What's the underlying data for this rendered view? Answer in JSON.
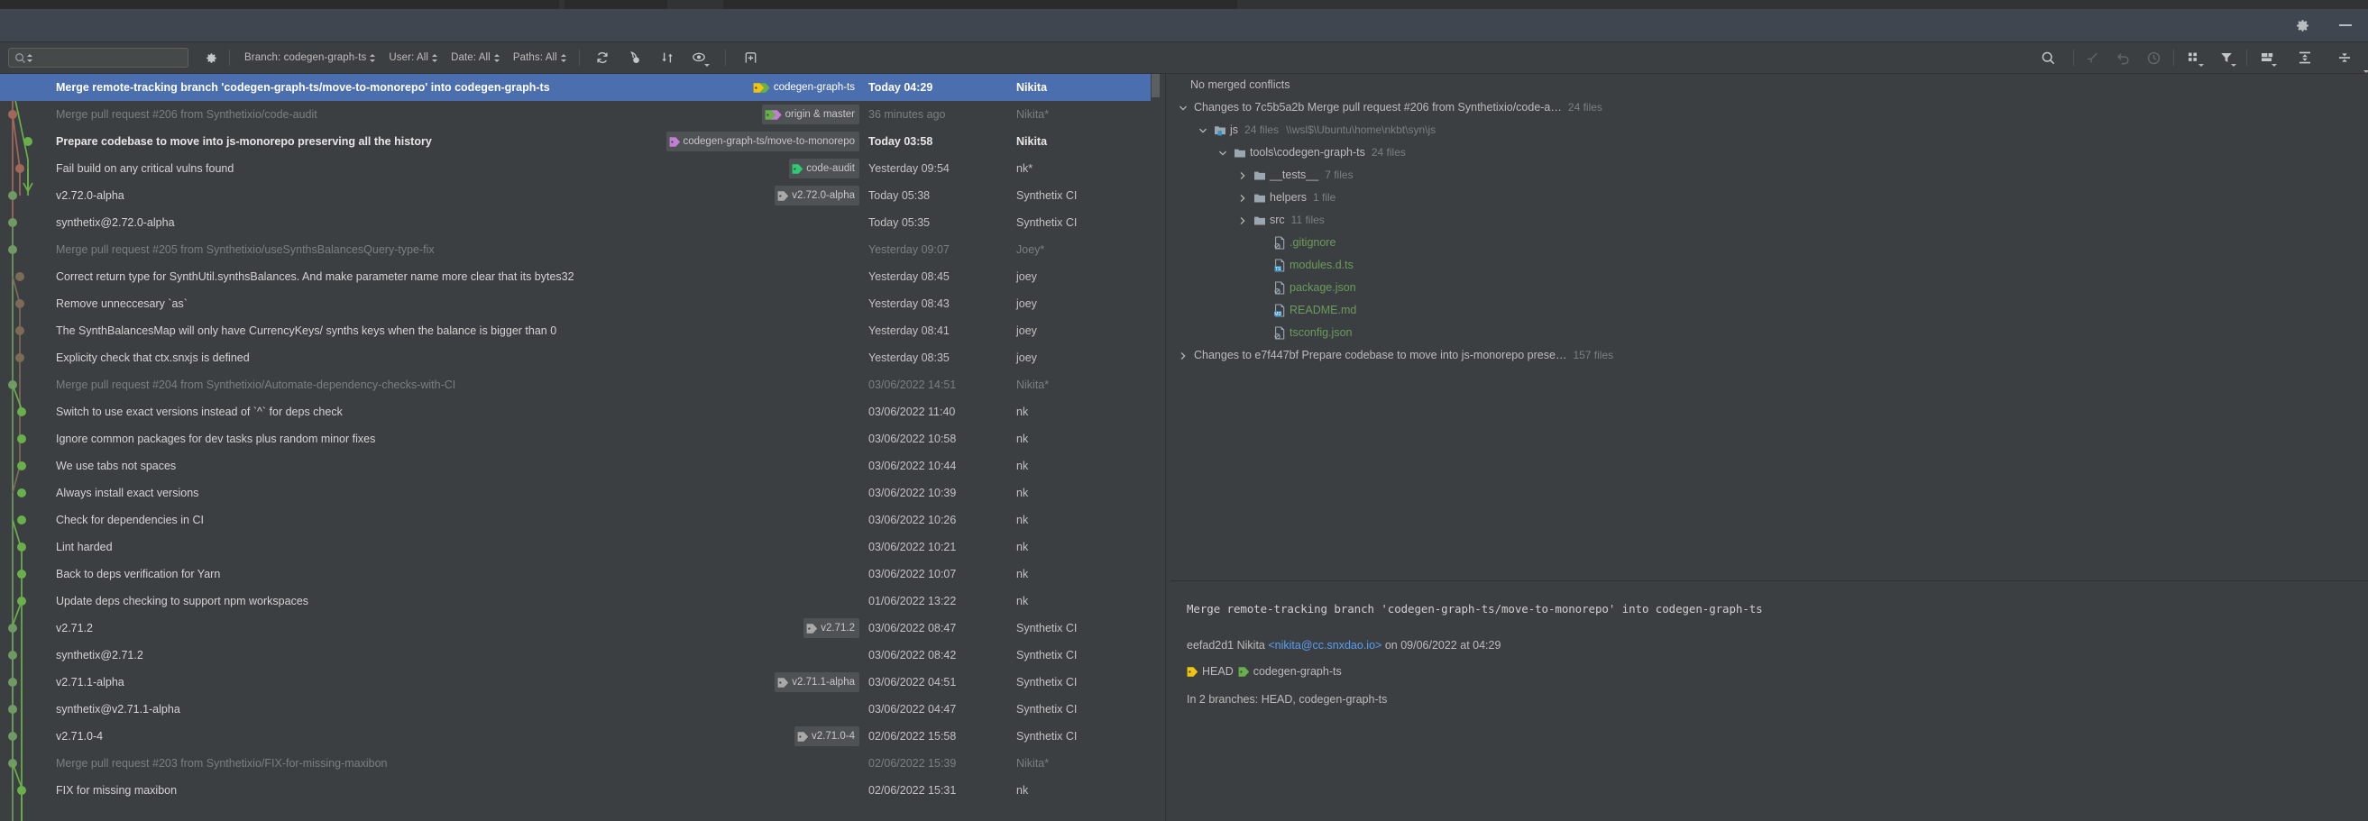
{
  "window": {
    "header_icons": [
      "gear-icon",
      "minimize-icon"
    ],
    "panel_icons": [
      "expand-all-icon",
      "collapse-all-icon"
    ]
  },
  "toolbar": {
    "search_placeholder": "",
    "search_value": "",
    "gear_label": "settings",
    "filters": [
      {
        "name": "branch-filter",
        "label": "Branch: codegen-graph-ts"
      },
      {
        "name": "user-filter",
        "label": "User: All"
      },
      {
        "name": "date-filter",
        "label": "Date: All"
      },
      {
        "name": "paths-filter",
        "label": "Paths: All"
      }
    ],
    "left_icons": [
      "refresh-icon",
      "cherry-pick-icon",
      "intelli-sort-icon",
      "show-hide-icon",
      "new-branch-icon"
    ],
    "right_icons": [
      "search-icon",
      "go-to-child-icon",
      "undo-icon",
      "history-icon",
      "group-by-icon",
      "filter-icon",
      "columns-icon"
    ]
  },
  "colors": {
    "selection": "#4b6eaf",
    "background": "#3c3f41",
    "header_band": "#3f4650",
    "branch_green": "#6ab04a",
    "branch_yellow": "#f1c40f",
    "branch_purple": "#c07fd0",
    "branch_gray": "#a9a9a9",
    "link": "#589df6",
    "file_green": "#6a9b5b"
  },
  "commits": [
    {
      "subject": "Merge remote-tracking branch 'codegen-graph-ts/move-to-monorepo' into codegen-graph-ts",
      "date": "Today 04:29",
      "author": "Nikita",
      "state": "selected",
      "refs": [
        {
          "label": "codegen-graph-ts",
          "color": "#f1c40f",
          "color2": "#6ab04a",
          "double": true
        }
      ]
    },
    {
      "subject": "Merge pull request #206 from Synthetixio/code-audit",
      "date": "36 minutes ago",
      "author": "Nikita*",
      "state": "dim",
      "refs": [
        {
          "label": "origin & master",
          "color": "#6ab04a",
          "color2": "#c07fd0",
          "double": true
        }
      ]
    },
    {
      "subject": "Prepare codebase to move into js-monorepo preserving all the history",
      "date": "Today 03:58",
      "author": "Nikita",
      "state": "bold",
      "refs": [
        {
          "label": "codegen-graph-ts/move-to-monorepo",
          "color": "#c07fd0",
          "double": false
        }
      ]
    },
    {
      "subject": "Fail build on any critical vulns found",
      "date": "Yesterday 09:54",
      "author": "nk*",
      "state": "normal",
      "refs": [
        {
          "label": "code-audit",
          "color": "#2ecc71",
          "double": false
        }
      ]
    },
    {
      "subject": "v2.72.0-alpha",
      "date": "Today 05:38",
      "author": "Synthetix CI",
      "state": "normal",
      "refs": [
        {
          "label": "v2.72.0-alpha",
          "color": "#a9a9a9",
          "double": false
        }
      ]
    },
    {
      "subject": "synthetix@2.72.0-alpha",
      "date": "Today 05:35",
      "author": "Synthetix CI",
      "state": "normal",
      "refs": []
    },
    {
      "subject": "Merge pull request #205 from Synthetixio/useSynthsBalancesQuery-type-fix",
      "date": "Yesterday 09:07",
      "author": "Joey*",
      "state": "dim",
      "refs": []
    },
    {
      "subject": "Correct return type for SynthUtil.synthsBalances. And make parameter name more clear that its bytes32",
      "date": "Yesterday 08:45",
      "author": "joey",
      "state": "normal",
      "refs": []
    },
    {
      "subject": "Remove unneccesary `as`",
      "date": "Yesterday 08:43",
      "author": "joey",
      "state": "normal",
      "refs": []
    },
    {
      "subject": "The SynthBalancesMap will only have CurrencyKeys/ synths keys when the balance is bigger than 0",
      "date": "Yesterday 08:41",
      "author": "joey",
      "state": "normal",
      "refs": []
    },
    {
      "subject": "Explicity check that ctx.snxjs is defined",
      "date": "Yesterday 08:35",
      "author": "joey",
      "state": "normal",
      "refs": []
    },
    {
      "subject": "Merge pull request #204 from Synthetixio/Automate-dependency-checks-with-CI",
      "date": "03/06/2022 14:51",
      "author": "Nikita*",
      "state": "dim",
      "refs": []
    },
    {
      "subject": "Switch to use exact versions instead of `^` for deps check",
      "date": "03/06/2022 11:40",
      "author": "nk",
      "state": "normal",
      "refs": []
    },
    {
      "subject": "Ignore common packages for dev tasks plus random minor fixes",
      "date": "03/06/2022 10:58",
      "author": "nk",
      "state": "normal",
      "refs": []
    },
    {
      "subject": "We use tabs not spaces",
      "date": "03/06/2022 10:44",
      "author": "nk",
      "state": "normal",
      "refs": []
    },
    {
      "subject": "Always install exact versions",
      "date": "03/06/2022 10:39",
      "author": "nk",
      "state": "normal",
      "refs": []
    },
    {
      "subject": "Check for dependencies in CI",
      "date": "03/06/2022 10:26",
      "author": "nk",
      "state": "normal",
      "refs": []
    },
    {
      "subject": "Lint harded",
      "date": "03/06/2022 10:21",
      "author": "nk",
      "state": "normal",
      "refs": []
    },
    {
      "subject": "Back to deps verification for Yarn",
      "date": "03/06/2022 10:07",
      "author": "nk",
      "state": "normal",
      "refs": []
    },
    {
      "subject": "Update deps checking to support npm workspaces",
      "date": "01/06/2022 13:22",
      "author": "nk",
      "state": "normal",
      "refs": []
    },
    {
      "subject": "v2.71.2",
      "date": "03/06/2022 08:47",
      "author": "Synthetix CI",
      "state": "normal",
      "refs": [
        {
          "label": "v2.71.2",
          "color": "#a9a9a9",
          "double": false
        }
      ]
    },
    {
      "subject": "synthetix@2.71.2",
      "date": "03/06/2022 08:42",
      "author": "Synthetix CI",
      "state": "normal",
      "refs": []
    },
    {
      "subject": "v2.71.1-alpha",
      "date": "03/06/2022 04:51",
      "author": "Synthetix CI",
      "state": "normal",
      "refs": [
        {
          "label": "v2.71.1-alpha",
          "color": "#a9a9a9",
          "double": false
        }
      ]
    },
    {
      "subject": "synthetix@v2.71.1-alpha",
      "date": "03/06/2022 04:47",
      "author": "Synthetix CI",
      "state": "normal",
      "refs": []
    },
    {
      "subject": "v2.71.0-4",
      "date": "02/06/2022 15:58",
      "author": "Synthetix CI",
      "state": "normal",
      "refs": [
        {
          "label": "v2.71.0-4",
          "color": "#a9a9a9",
          "double": false
        }
      ]
    },
    {
      "subject": "Merge pull request #203 from Synthetixio/FIX-for-missing-maxibon",
      "date": "02/06/2022 15:39",
      "author": "Nikita*",
      "state": "dim",
      "refs": []
    },
    {
      "subject": "FIX for missing maxibon",
      "date": "02/06/2022 15:31",
      "author": "nk",
      "state": "normal",
      "refs": []
    }
  ],
  "changes": {
    "conflicts_text": "No merged conflicts",
    "tree": [
      {
        "name": "changes-node-1",
        "indent": 0,
        "twist": "down",
        "icon": "none",
        "label": "Changes to 7c5b5a2b Merge pull request #206 from Synthetixio/code-a…",
        "count": "24 files",
        "path": "",
        "color": "#bbbbbb"
      },
      {
        "name": "module-js",
        "indent": 1,
        "twist": "down",
        "icon": "module",
        "label": "js",
        "count": "24 files",
        "path": "\\\\wsl$\\Ubuntu\\home\\nkbt\\syn\\js",
        "color": "#bbbbbb"
      },
      {
        "name": "folder-tools",
        "indent": 2,
        "twist": "down",
        "icon": "folder",
        "label": "tools\\codegen-graph-ts",
        "count": "24 files",
        "path": "",
        "color": "#bbbbbb"
      },
      {
        "name": "folder-tests",
        "indent": 3,
        "twist": "right",
        "icon": "folder",
        "label": "__tests__",
        "count": "7 files",
        "path": "",
        "color": "#bbbbbb"
      },
      {
        "name": "folder-helpers",
        "indent": 3,
        "twist": "right",
        "icon": "folder",
        "label": "helpers",
        "count": "1 file",
        "path": "",
        "color": "#bbbbbb"
      },
      {
        "name": "folder-src",
        "indent": 3,
        "twist": "right",
        "icon": "folder",
        "label": "src",
        "count": "11 files",
        "path": "",
        "color": "#bbbbbb"
      },
      {
        "name": "file-gitignore",
        "indent": 4,
        "twist": "none",
        "icon": "file-ignore",
        "label": ".gitignore",
        "count": "",
        "path": "",
        "color": "#6a9b5b"
      },
      {
        "name": "file-modules",
        "indent": 4,
        "twist": "none",
        "icon": "file-ts",
        "label": "modules.d.ts",
        "count": "",
        "path": "",
        "color": "#6a9b5b"
      },
      {
        "name": "file-package",
        "indent": 4,
        "twist": "none",
        "icon": "file-json",
        "label": "package.json",
        "count": "",
        "path": "",
        "color": "#6a9b5b"
      },
      {
        "name": "file-readme",
        "indent": 4,
        "twist": "none",
        "icon": "file-md",
        "label": "README.md",
        "count": "",
        "path": "",
        "color": "#6a9b5b"
      },
      {
        "name": "file-tsconfig",
        "indent": 4,
        "twist": "none",
        "icon": "file-json",
        "label": "tsconfig.json",
        "count": "",
        "path": "",
        "color": "#6a9b5b"
      },
      {
        "name": "changes-node-2",
        "indent": 0,
        "twist": "right",
        "icon": "none",
        "label": "Changes to e7f447bf Prepare codebase to move into js-monorepo prese…",
        "count": "157 files",
        "path": "",
        "color": "#bbbbbb"
      }
    ]
  },
  "details": {
    "message": "Merge remote-tracking branch 'codegen-graph-ts/move-to-monorepo' into codegen-graph-ts",
    "hash": "eefad2d1",
    "author": "Nikita",
    "email": "<nikita@cc.snxdao.io>",
    "on_word": "on",
    "datetime": "09/06/2022 at 04:29",
    "refs": [
      {
        "label": "HEAD",
        "color": "#f1c40f"
      },
      {
        "label": "codegen-graph-ts",
        "color": "#6ab04a"
      }
    ],
    "branches_text": "In 2 branches: HEAD, codegen-graph-ts"
  }
}
